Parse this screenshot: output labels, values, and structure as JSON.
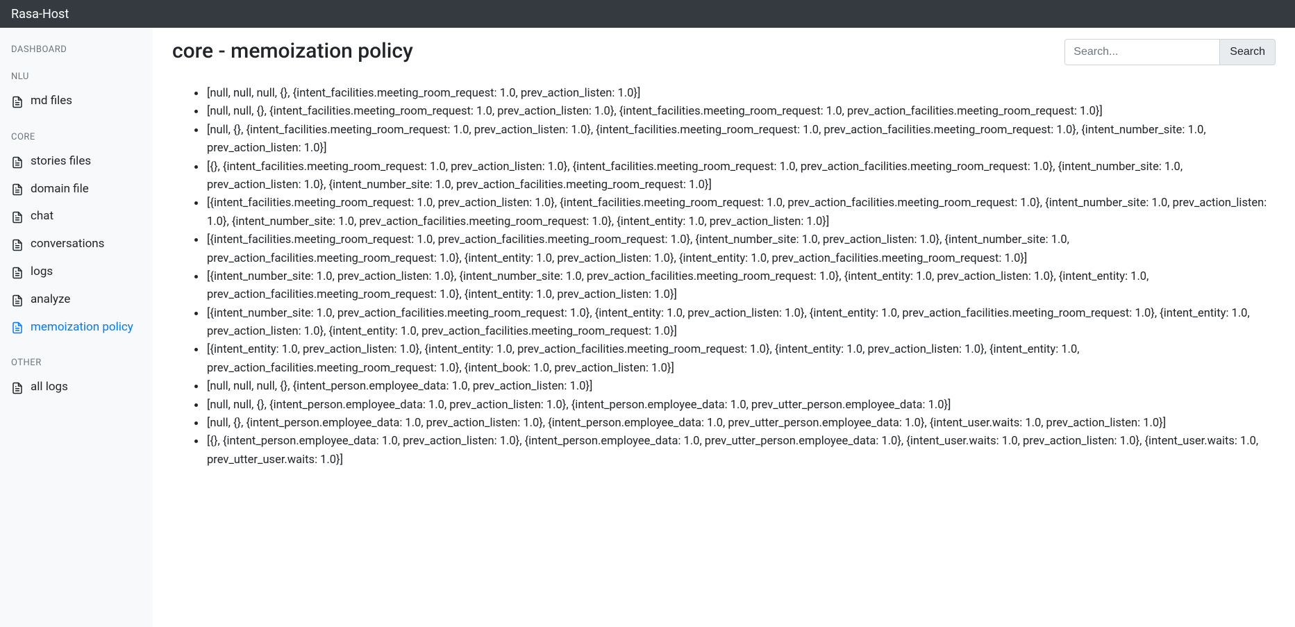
{
  "topbar": {
    "title": "Rasa-Host"
  },
  "sidebar": {
    "sections": [
      {
        "heading": "DASHBOARD",
        "items": []
      },
      {
        "heading": "NLU",
        "items": [
          {
            "label": "md files",
            "name": "sidebar-item-md-files",
            "active": false
          }
        ]
      },
      {
        "heading": "CORE",
        "items": [
          {
            "label": "stories files",
            "name": "sidebar-item-stories-files",
            "active": false
          },
          {
            "label": "domain file",
            "name": "sidebar-item-domain-file",
            "active": false
          },
          {
            "label": "chat",
            "name": "sidebar-item-chat",
            "active": false
          },
          {
            "label": "conversations",
            "name": "sidebar-item-conversations",
            "active": false
          },
          {
            "label": "logs",
            "name": "sidebar-item-logs",
            "active": false
          },
          {
            "label": "analyze",
            "name": "sidebar-item-analyze",
            "active": false
          },
          {
            "label": "memoization policy",
            "name": "sidebar-item-memoization-policy",
            "active": true
          }
        ]
      },
      {
        "heading": "OTHER",
        "items": [
          {
            "label": "all logs",
            "name": "sidebar-item-all-logs",
            "active": false
          }
        ]
      }
    ]
  },
  "header": {
    "title": "core - memoization policy",
    "search_placeholder": "Search...",
    "search_button": "Search"
  },
  "entries": [
    "[null, null, null, {}, {intent_facilities.meeting_room_request: 1.0, prev_action_listen: 1.0}]",
    "[null, null, {}, {intent_facilities.meeting_room_request: 1.0, prev_action_listen: 1.0}, {intent_facilities.meeting_room_request: 1.0, prev_action_facilities.meeting_room_request: 1.0}]",
    "[null, {}, {intent_facilities.meeting_room_request: 1.0, prev_action_listen: 1.0}, {intent_facilities.meeting_room_request: 1.0, prev_action_facilities.meeting_room_request: 1.0}, {intent_number_site: 1.0, prev_action_listen: 1.0}]",
    "[{}, {intent_facilities.meeting_room_request: 1.0, prev_action_listen: 1.0}, {intent_facilities.meeting_room_request: 1.0, prev_action_facilities.meeting_room_request: 1.0}, {intent_number_site: 1.0, prev_action_listen: 1.0}, {intent_number_site: 1.0, prev_action_facilities.meeting_room_request: 1.0}]",
    "[{intent_facilities.meeting_room_request: 1.0, prev_action_listen: 1.0}, {intent_facilities.meeting_room_request: 1.0, prev_action_facilities.meeting_room_request: 1.0}, {intent_number_site: 1.0, prev_action_listen: 1.0}, {intent_number_site: 1.0, prev_action_facilities.meeting_room_request: 1.0}, {intent_entity: 1.0, prev_action_listen: 1.0}]",
    "[{intent_facilities.meeting_room_request: 1.0, prev_action_facilities.meeting_room_request: 1.0}, {intent_number_site: 1.0, prev_action_listen: 1.0}, {intent_number_site: 1.0, prev_action_facilities.meeting_room_request: 1.0}, {intent_entity: 1.0, prev_action_listen: 1.0}, {intent_entity: 1.0, prev_action_facilities.meeting_room_request: 1.0}]",
    "[{intent_number_site: 1.0, prev_action_listen: 1.0}, {intent_number_site: 1.0, prev_action_facilities.meeting_room_request: 1.0}, {intent_entity: 1.0, prev_action_listen: 1.0}, {intent_entity: 1.0, prev_action_facilities.meeting_room_request: 1.0}, {intent_entity: 1.0, prev_action_listen: 1.0}]",
    "[{intent_number_site: 1.0, prev_action_facilities.meeting_room_request: 1.0}, {intent_entity: 1.0, prev_action_listen: 1.0}, {intent_entity: 1.0, prev_action_facilities.meeting_room_request: 1.0}, {intent_entity: 1.0, prev_action_listen: 1.0}, {intent_entity: 1.0, prev_action_facilities.meeting_room_request: 1.0}]",
    "[{intent_entity: 1.0, prev_action_listen: 1.0}, {intent_entity: 1.0, prev_action_facilities.meeting_room_request: 1.0}, {intent_entity: 1.0, prev_action_listen: 1.0}, {intent_entity: 1.0, prev_action_facilities.meeting_room_request: 1.0}, {intent_book: 1.0, prev_action_listen: 1.0}]",
    "[null, null, null, {}, {intent_person.employee_data: 1.0, prev_action_listen: 1.0}]",
    "[null, null, {}, {intent_person.employee_data: 1.0, prev_action_listen: 1.0}, {intent_person.employee_data: 1.0, prev_utter_person.employee_data: 1.0}]",
    "[null, {}, {intent_person.employee_data: 1.0, prev_action_listen: 1.0}, {intent_person.employee_data: 1.0, prev_utter_person.employee_data: 1.0}, {intent_user.waits: 1.0, prev_action_listen: 1.0}]",
    "[{}, {intent_person.employee_data: 1.0, prev_action_listen: 1.0}, {intent_person.employee_data: 1.0, prev_utter_person.employee_data: 1.0}, {intent_user.waits: 1.0, prev_action_listen: 1.0}, {intent_user.waits: 1.0, prev_utter_user.waits: 1.0}]"
  ]
}
